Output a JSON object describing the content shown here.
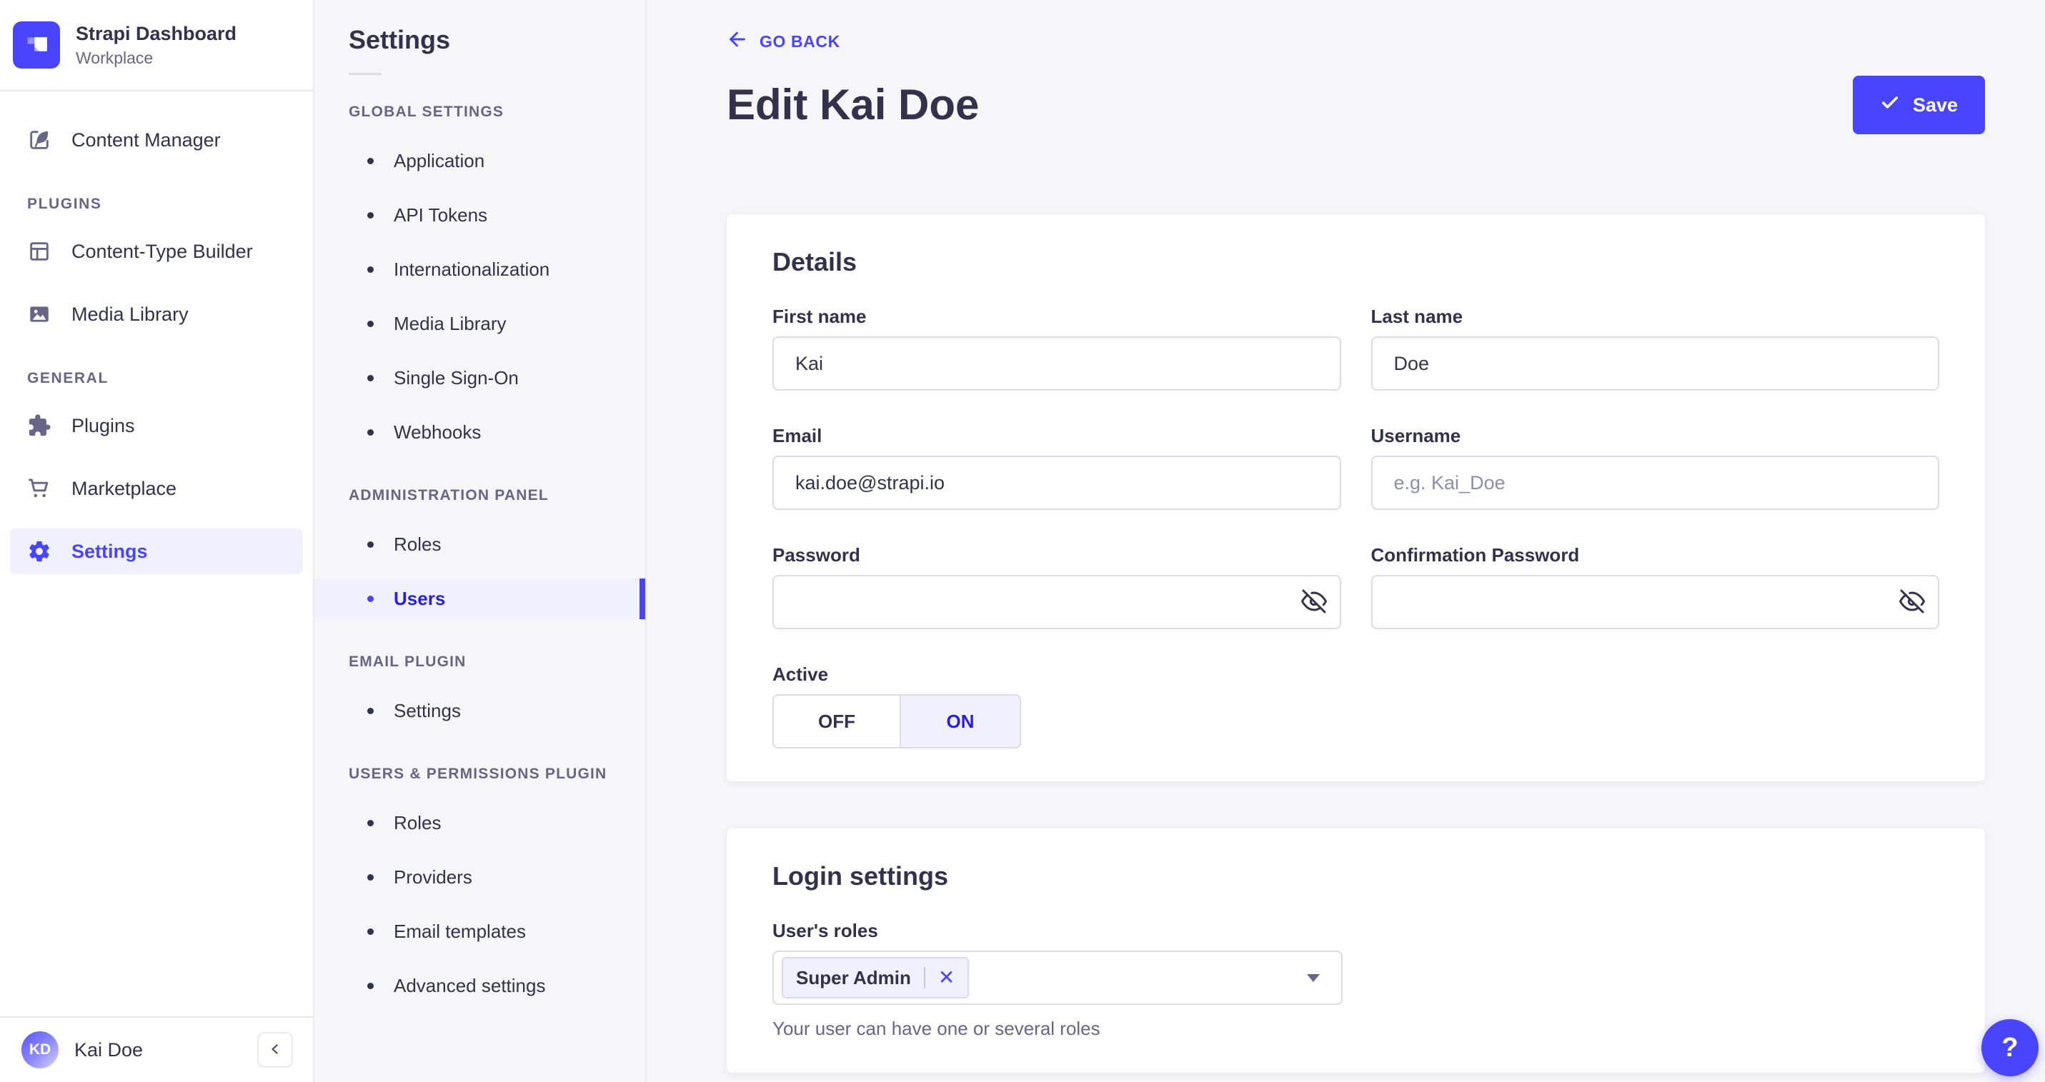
{
  "brand": {
    "title": "Strapi Dashboard",
    "subtitle": "Workplace"
  },
  "nav": {
    "content_manager": "Content Manager",
    "plugins_section": "PLUGINS",
    "content_type_builder": "Content-Type Builder",
    "media_library": "Media Library",
    "general_section": "GENERAL",
    "plugins": "Plugins",
    "marketplace": "Marketplace",
    "settings": "Settings",
    "user_initials": "KD",
    "user_name": "Kai Doe"
  },
  "subnav": {
    "title": "Settings",
    "active": "Users",
    "sections": [
      {
        "label": "GLOBAL SETTINGS",
        "items": [
          "Application",
          "API Tokens",
          "Internationalization",
          "Media Library",
          "Single Sign-On",
          "Webhooks"
        ]
      },
      {
        "label": "ADMINISTRATION PANEL",
        "items": [
          "Roles",
          "Users"
        ]
      },
      {
        "label": "EMAIL PLUGIN",
        "items": [
          "Settings"
        ]
      },
      {
        "label": "USERS & PERMISSIONS PLUGIN",
        "items": [
          "Roles",
          "Providers",
          "Email templates",
          "Advanced settings"
        ]
      }
    ]
  },
  "header": {
    "back": "GO BACK",
    "title": "Edit Kai Doe",
    "save": "Save"
  },
  "details": {
    "title": "Details",
    "first_name_label": "First name",
    "first_name_value": "Kai",
    "last_name_label": "Last name",
    "last_name_value": "Doe",
    "email_label": "Email",
    "email_value": "kai.doe@strapi.io",
    "username_label": "Username",
    "username_placeholder": "e.g. Kai_Doe",
    "password_label": "Password",
    "confirmation_label": "Confirmation Password",
    "active_label": "Active",
    "off": "OFF",
    "on": "ON",
    "active_value": "ON"
  },
  "login": {
    "title": "Login settings",
    "roles_label": "User's roles",
    "role_tag": "Super Admin",
    "remove_tag": "✕",
    "hint": "Your user can have one or several roles"
  },
  "help": {
    "label": "?"
  },
  "colors": {
    "primary": "#4945ff",
    "primary_light": "#f0f0ff",
    "text": "#32324d",
    "muted": "#666687",
    "input_border": "#dcdce4",
    "divider": "#eaeaef",
    "page_bg": "#f6f6f9"
  }
}
